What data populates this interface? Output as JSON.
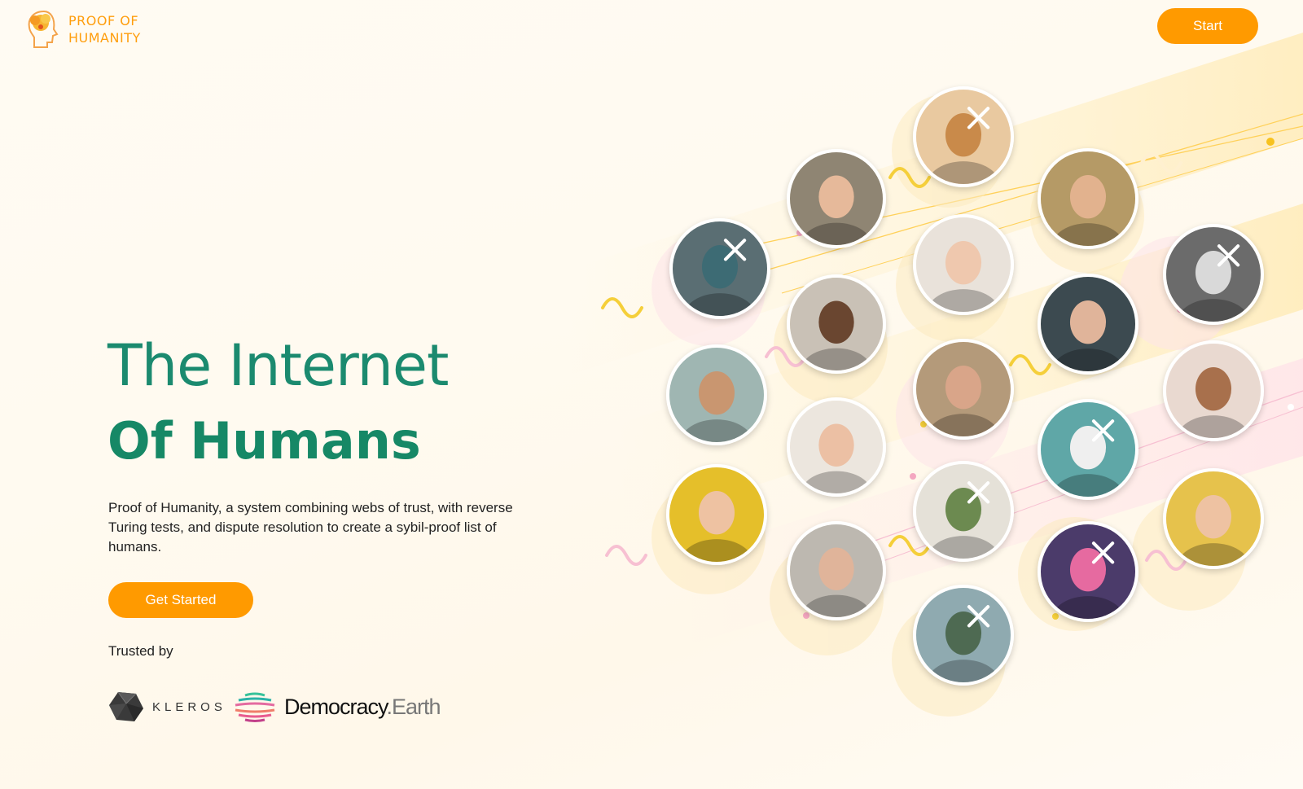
{
  "header": {
    "logo_line1": "PROOF OF",
    "logo_line2": "HUMANITY",
    "start_label": "Start"
  },
  "hero": {
    "title_line1": "The Internet",
    "title_line2": "Of Humans",
    "description": "Proof of Humanity, a system combining webs of trust, with reverse Turing tests, and dispute resolution to create a sybil-proof list of humans.",
    "cta_label": "Get Started"
  },
  "trusted": {
    "label": "Trusted by",
    "partners": [
      {
        "name": "KLEROS",
        "icon": "kleros-logo-icon"
      },
      {
        "name_bold": "Democracy",
        "name_thin": ".Earth",
        "icon": "democracy-earth-logo-icon"
      }
    ]
  },
  "colors": {
    "accent": "#ff9a00",
    "title_green": "#168866",
    "background": "#fffaf0"
  },
  "avatars": [
    {
      "name": "dog-party-hat",
      "rejected": true,
      "bg": "#e9c9a0",
      "face": "#c98a4a"
    },
    {
      "name": "woman-blonde",
      "rejected": false,
      "bg": "#8f8573",
      "face": "#e6b99a"
    },
    {
      "name": "woman-brunette-smiling",
      "rejected": false,
      "bg": "#b59a66",
      "face": "#e2b28e"
    },
    {
      "name": "robot-toy",
      "rejected": true,
      "bg": "#5a6e73",
      "face": "#3d6b74"
    },
    {
      "name": "woman-hair-bun",
      "rejected": false,
      "bg": "#e9e2da",
      "face": "#efc8ae"
    },
    {
      "name": "astronaut",
      "rejected": true,
      "bg": "#6b6b6b",
      "face": "#d9d9d9"
    },
    {
      "name": "man-smiling-dark-skin",
      "rejected": false,
      "bg": "#c9c1b6",
      "face": "#6a4630"
    },
    {
      "name": "man-suit",
      "rejected": false,
      "bg": "#3c4a50",
      "face": "#e0b49a"
    },
    {
      "name": "woman-curly-hair",
      "rejected": false,
      "bg": "#9fb6b2",
      "face": "#c99670"
    },
    {
      "name": "older-man",
      "rejected": false,
      "bg": "#b49a7a",
      "face": "#d9a589"
    },
    {
      "name": "woman-curly-glasses",
      "rejected": false,
      "bg": "#e9d9d0",
      "face": "#a8704c"
    },
    {
      "name": "woman-pink-blazer",
      "rejected": false,
      "bg": "#ece6de",
      "face": "#ecc0a4"
    },
    {
      "name": "panda-mask",
      "rejected": true,
      "bg": "#5fa7a7",
      "face": "#efefef"
    },
    {
      "name": "woman-yellow-bg",
      "rejected": false,
      "bg": "#e5bf2a",
      "face": "#eec2a2"
    },
    {
      "name": "woman-leaf",
      "rejected": true,
      "bg": "#e5e1d8",
      "face": "#6c8a50"
    },
    {
      "name": "man-glasses",
      "rejected": false,
      "bg": "#bdb8b0",
      "face": "#e0b49a"
    },
    {
      "name": "colorful-mask",
      "rejected": true,
      "bg": "#4b3b6a",
      "face": "#e66aa0"
    },
    {
      "name": "young-man-yellow-bg",
      "rejected": false,
      "bg": "#e6c24c",
      "face": "#eec2a2"
    },
    {
      "name": "armored-soldier",
      "rejected": true,
      "bg": "#8faab0",
      "face": "#4e6a52"
    }
  ]
}
